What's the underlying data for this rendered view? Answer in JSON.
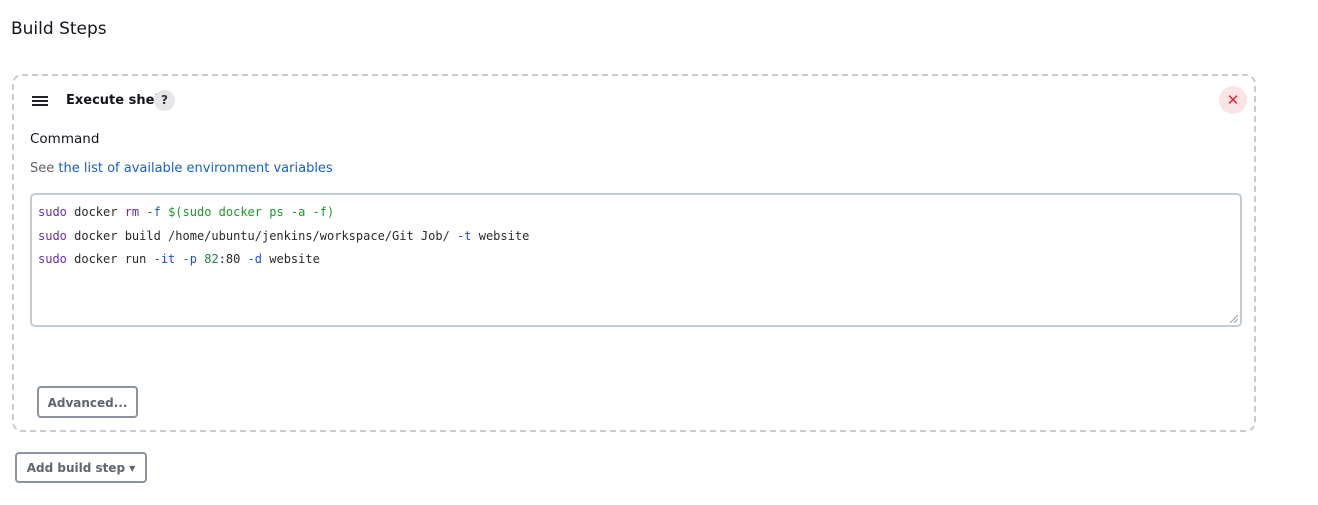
{
  "section": {
    "title": "Build Steps"
  },
  "step": {
    "title": "Execute shell",
    "help_label": "?",
    "close_label": "✕",
    "drag_icon": "hamburger-icon",
    "command_label": "Command",
    "env_prefix": "See ",
    "env_link": "the list of available environment variables",
    "command_lines": [
      [
        {
          "t": "sudo",
          "c": "kw"
        },
        {
          "t": " docker ",
          "c": "cmd"
        },
        {
          "t": "rm",
          "c": "builtin"
        },
        {
          "t": " ",
          "c": "cmd"
        },
        {
          "t": "-f",
          "c": "flag"
        },
        {
          "t": " ",
          "c": "cmd"
        },
        {
          "t": "$(sudo docker ps -a -f)",
          "c": "sub"
        }
      ],
      [
        {
          "t": "sudo",
          "c": "kw"
        },
        {
          "t": " docker build /home/ubuntu/jenkins/workspace/Git Job/ ",
          "c": "cmd"
        },
        {
          "t": "-t",
          "c": "flag"
        },
        {
          "t": " website",
          "c": "cmd"
        }
      ],
      [
        {
          "t": "sudo",
          "c": "kw"
        },
        {
          "t": " docker run ",
          "c": "cmd"
        },
        {
          "t": "-it",
          "c": "flag"
        },
        {
          "t": " ",
          "c": "cmd"
        },
        {
          "t": "-p",
          "c": "flag"
        },
        {
          "t": " ",
          "c": "cmd"
        },
        {
          "t": "82",
          "c": "num"
        },
        {
          "t": ":80 ",
          "c": "cmd"
        },
        {
          "t": "-d",
          "c": "flag"
        },
        {
          "t": " website",
          "c": "cmd"
        }
      ]
    ],
    "advanced_label": "Advanced..."
  },
  "add_step": {
    "label": "Add build step",
    "caret": "▼"
  }
}
